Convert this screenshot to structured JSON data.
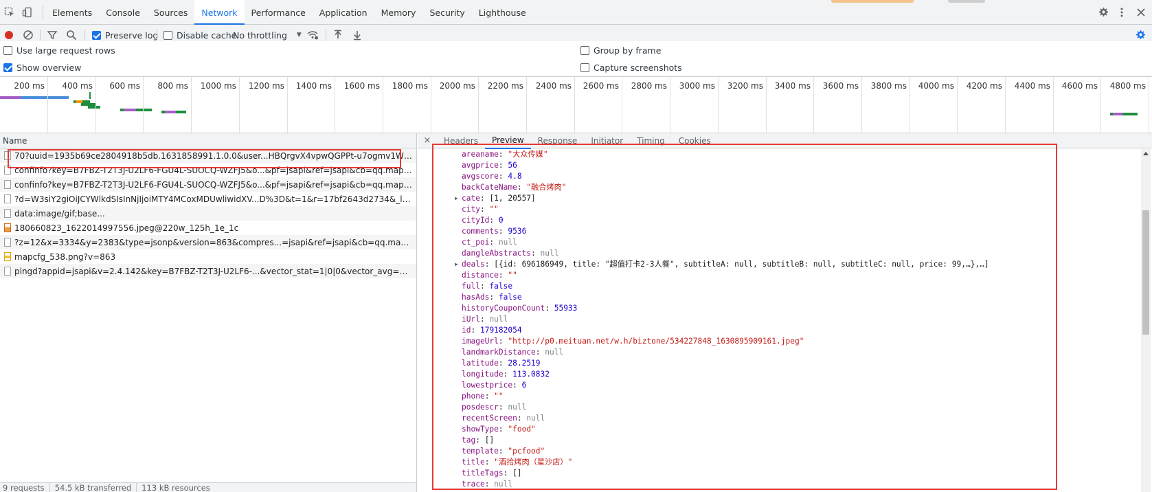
{
  "devtools": {
    "tabs": [
      {
        "label": "Elements"
      },
      {
        "label": "Console"
      },
      {
        "label": "Sources"
      },
      {
        "label": "Network"
      },
      {
        "label": "Performance"
      },
      {
        "label": "Application"
      },
      {
        "label": "Memory"
      },
      {
        "label": "Security"
      },
      {
        "label": "Lighthouse"
      }
    ],
    "active_tab": "Network"
  },
  "toolbar": {
    "preserve_log": {
      "label": "Preserve log",
      "checked": true
    },
    "disable_cache": {
      "label": "Disable cache",
      "checked": false
    },
    "throttling": "No throttling"
  },
  "settings": {
    "large_rows": {
      "label": "Use large request rows",
      "checked": false
    },
    "show_overview": {
      "label": "Show overview",
      "checked": true
    },
    "group_by_frame": {
      "label": "Group by frame",
      "checked": false
    },
    "capture_screenshots": {
      "label": "Capture screenshots",
      "checked": false
    }
  },
  "overview": {
    "ticks": [
      "200 ms",
      "400 ms",
      "600 ms",
      "800 ms",
      "1000 ms",
      "1200 ms",
      "1400 ms",
      "1600 ms",
      "1800 ms",
      "2000 ms",
      "2200 ms",
      "2400 ms",
      "2600 ms",
      "2800 ms",
      "3000 ms",
      "3200 ms",
      "3400 ms",
      "3600 ms",
      "3800 ms",
      "4000 ms",
      "4200 ms",
      "4400 ms",
      "4600 ms",
      "4800 ms"
    ]
  },
  "requests": {
    "column": "Name",
    "items": [
      {
        "name": "70?uuid=1935b69ce2804918b5db.1631858991.1.0.0&user...HBQrgvX4vpwQGPPt-u7ogmv1WDFs8pHWNC0...",
        "kind": "doc"
      },
      {
        "name": "confinfo?key=B7FBZ-T2T3J-U2LF6-FGU4L-SUOCQ-WZFJ5&o...&pf=jsapi&ref=jsapi&cb=qq.maps._svcb3.cbk...",
        "kind": "doc"
      },
      {
        "name": "confinfo?key=B7FBZ-T2T3J-U2LF6-FGU4L-SUOCQ-WZFJ5&o...&pf=jsapi&ref=jsapi&cb=qq.maps._svcb3.cbk...",
        "kind": "doc"
      },
      {
        "name": "?d=W3siY2giOiJCYWlkdSIsInNjIjoiMTY4MCoxMDUwliwidXV...D%3D&t=1&r=17bf2643d2734&_lxsdk_rnd=1...",
        "kind": "doc"
      },
      {
        "name": "data:image/gif;base...",
        "kind": "doc"
      },
      {
        "name": "180660823_1622014997556.jpeg@220w_125h_1e_1c",
        "kind": "img"
      },
      {
        "name": "?z=12&x=3334&y=2383&type=jsonp&version=863&compres...=jsapi&ref=jsapi&cb=qq.maps._svcb3.td33...",
        "kind": "doc"
      },
      {
        "name": "mapcfg_538.png?v=863",
        "kind": "png"
      },
      {
        "name": "pingd?appid=jsapi&v=2.4.142&key=B7FBZ-T2T3J-U2LF6-...&vector_stat=1|0|0&vector_avg=150&random=...",
        "kind": "doc"
      }
    ]
  },
  "status": {
    "requests": "9 requests",
    "transferred": "54.5 kB transferred",
    "resources": "113 kB resources"
  },
  "detail": {
    "close": "×",
    "tabs": [
      "Headers",
      "Preview",
      "Response",
      "Initiator",
      "Timing",
      "Cookies"
    ],
    "active_tab": "Preview"
  },
  "preview": [
    {
      "key": "areaname",
      "value": "\"大众传媒\"",
      "type": "s",
      "expand": false
    },
    {
      "key": "avgprice",
      "value": "56",
      "type": "n",
      "expand": false
    },
    {
      "key": "avgscore",
      "value": "4.8",
      "type": "n",
      "expand": false
    },
    {
      "key": "backCateName",
      "value": "\"融合烤肉\"",
      "type": "s",
      "expand": false
    },
    {
      "key": "cate",
      "value": "[1, 20557]",
      "type": "o",
      "expand": true
    },
    {
      "key": "city",
      "value": "\"\"",
      "type": "s",
      "expand": false
    },
    {
      "key": "cityId",
      "value": "0",
      "type": "n",
      "expand": false
    },
    {
      "key": "comments",
      "value": "9536",
      "type": "n",
      "expand": false
    },
    {
      "key": "ct_poi",
      "value": "null",
      "type": "nl",
      "expand": false
    },
    {
      "key": "dangleAbstracts",
      "value": "null",
      "type": "nl",
      "expand": false
    },
    {
      "key": "deals",
      "value": "[{id: 696186949, title: \"超值打卡2-3人餐\", subtitleA: null, subtitleB: null, subtitleC: null, price: 99,…},…]",
      "type": "o",
      "expand": true
    },
    {
      "key": "distance",
      "value": "\"\"",
      "type": "s",
      "expand": false
    },
    {
      "key": "full",
      "value": "false",
      "type": "n",
      "expand": false
    },
    {
      "key": "hasAds",
      "value": "false",
      "type": "n",
      "expand": false
    },
    {
      "key": "historyCouponCount",
      "value": "55933",
      "type": "n",
      "expand": false
    },
    {
      "key": "iUrl",
      "value": "null",
      "type": "nl",
      "expand": false
    },
    {
      "key": "id",
      "value": "179182054",
      "type": "n",
      "expand": false
    },
    {
      "key": "imageUrl",
      "value": "\"http://p0.meituan.net/w.h/biztone/534227848_1630895909161.jpeg\"",
      "type": "s",
      "expand": false
    },
    {
      "key": "landmarkDistance",
      "value": "null",
      "type": "nl",
      "expand": false
    },
    {
      "key": "latitude",
      "value": "28.2519",
      "type": "n",
      "expand": false
    },
    {
      "key": "longitude",
      "value": "113.0832",
      "type": "n",
      "expand": false
    },
    {
      "key": "lowestprice",
      "value": "6",
      "type": "n",
      "expand": false
    },
    {
      "key": "phone",
      "value": "\"\"",
      "type": "s",
      "expand": false
    },
    {
      "key": "posdescr",
      "value": "null",
      "type": "nl",
      "expand": false
    },
    {
      "key": "recentScreen",
      "value": "null",
      "type": "nl",
      "expand": false
    },
    {
      "key": "showType",
      "value": "\"food\"",
      "type": "s",
      "expand": false
    },
    {
      "key": "tag",
      "value": "[]",
      "type": "o",
      "expand": false
    },
    {
      "key": "template",
      "value": "\"pcfood\"",
      "type": "s",
      "expand": false
    },
    {
      "key": "title",
      "value": "\"酒拾烤肉（星沙店）\"",
      "type": "s",
      "expand": false
    },
    {
      "key": "titleTags",
      "value": "[]",
      "type": "o",
      "expand": false
    },
    {
      "key": "trace",
      "value": "null",
      "type": "nl",
      "expand": false
    }
  ],
  "colors": {
    "accent": "#1a73e8",
    "record": "#d93025",
    "highlight": "#e53935",
    "string": "#c41a16",
    "number": "#1c00cf",
    "key": "#881280"
  },
  "icons": [
    "inspect-icon",
    "device-toggle-icon",
    "settings-gear-icon",
    "more-vert-icon",
    "close-icon",
    "record-icon",
    "clear-icon",
    "filter-icon",
    "search-icon",
    "wifi-settings-icon",
    "import-icon",
    "export-icon",
    "network-settings-icon"
  ]
}
